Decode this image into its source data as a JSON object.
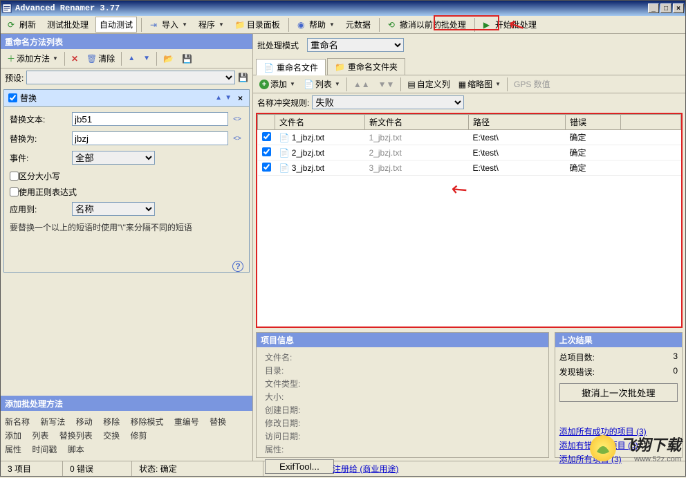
{
  "window": {
    "title": "Advanced Renamer 3.77"
  },
  "toolbar": {
    "refresh": "刷新",
    "test_batch": "测试批处理",
    "auto_test": "自动测试",
    "import": "导入",
    "program": "程序",
    "folder_panel": "目录面板",
    "help": "帮助",
    "metadata": "元数据",
    "undo_batch": "撤消以前的批处理",
    "start_batch": "开始批处理"
  },
  "left": {
    "title": "重命名方法列表",
    "add_method": "添加方法",
    "clear": "清除",
    "preset_label": "预设:",
    "method": {
      "name": "替换",
      "replace_text_label": "替换文本:",
      "replace_text_value": "jb51",
      "replace_with_label": "替换为:",
      "replace_with_value": "jbzj",
      "event_label": "事件:",
      "event_value": "全部",
      "case_sensitive": "区分大小写",
      "use_regex": "使用正则表达式",
      "apply_to_label": "应用到:",
      "apply_to_value": "名称",
      "hint": "要替换一个以上的短语时使用\"\\\"来分隔不同的短语"
    },
    "add_batch_title": "添加批处理方法",
    "add_batch_items": [
      "新名称",
      "新写法",
      "移动",
      "移除",
      "移除模式",
      "重编号",
      "替换",
      "添加",
      "列表",
      "替换列表",
      "交换",
      "修剪",
      "属性",
      "时间戳",
      "脚本"
    ]
  },
  "right": {
    "batch_mode_label": "批处理模式",
    "batch_mode_value": "重命名",
    "tab_files": "重命名文件",
    "tab_folders": "重命名文件夹",
    "file_toolbar": {
      "add": "添加",
      "list": "列表",
      "custom_cols": "自定义列",
      "thumbnails": "缩略图",
      "gps": "GPS 数值"
    },
    "conflict_label": "名称冲突规则:",
    "conflict_value": "失败",
    "columns": {
      "filename": "文件名",
      "newname": "新文件名",
      "path": "路径",
      "error": "错误"
    },
    "rows": [
      {
        "filename": "1_jbzj.txt",
        "newname": "1_jbzj.txt",
        "path": "E:\\test\\",
        "error": "确定"
      },
      {
        "filename": "2_jbzj.txt",
        "newname": "2_jbzj.txt",
        "path": "E:\\test\\",
        "error": "确定"
      },
      {
        "filename": "3_jbzj.txt",
        "newname": "3_jbzj.txt",
        "path": "E:\\test\\",
        "error": "确定"
      }
    ]
  },
  "info": {
    "title": "项目信息",
    "filename": "文件名:",
    "folder": "目录:",
    "filetype": "文件类型:",
    "size": "大小:",
    "created": "创建日期:",
    "modified": "修改日期:",
    "accessed": "访问日期:",
    "attrs": "属性:",
    "exif_btn": "ExifTool..."
  },
  "result": {
    "title": "上次结果",
    "total_label": "总项目数:",
    "total_value": "3",
    "errors_label": "发现错误:",
    "errors_value": "0",
    "undo_btn": "撤消上一次批处理",
    "link_success": "添加所有成功的项目 (3)",
    "link_error": "添加有错误的项目 (0)",
    "link_all": "添加所有项目 (3)"
  },
  "status": {
    "items": "3 项目",
    "errors": "0 错误",
    "state_label": "状态:",
    "state_value": "确定",
    "register": "注册给 (商业用途)"
  },
  "watermark": {
    "big": "飞翔下载",
    "small": "www.52z.com"
  }
}
